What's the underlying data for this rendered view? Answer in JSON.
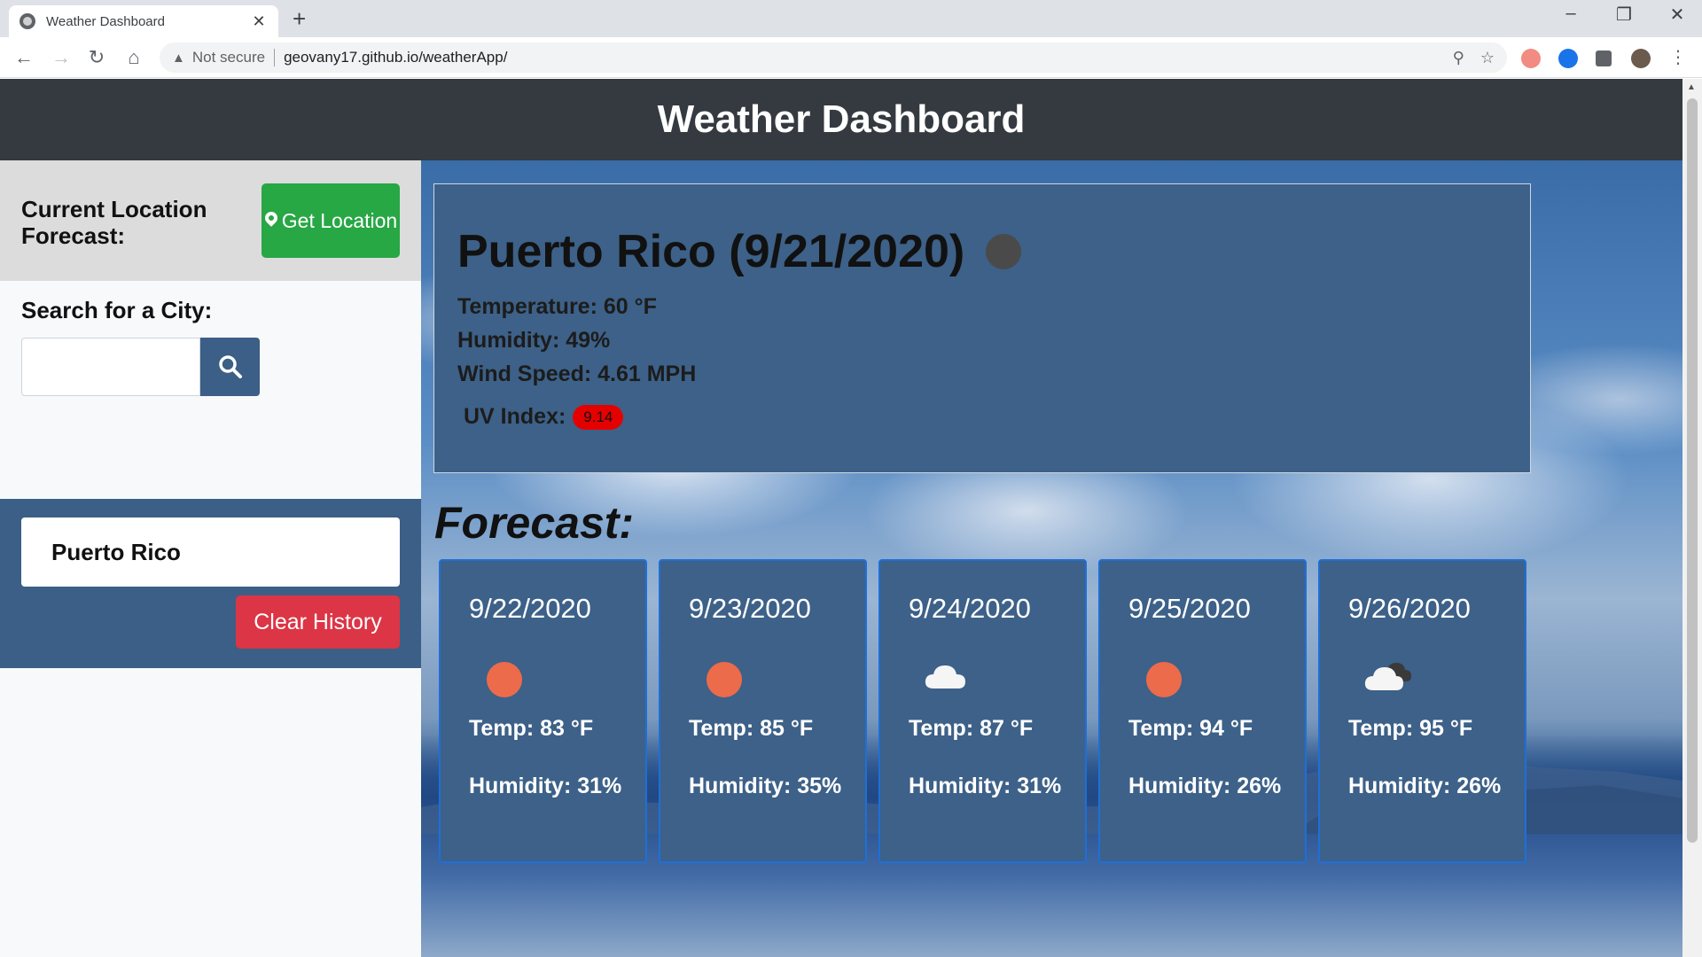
{
  "browser": {
    "tab_title": "Weather Dashboard",
    "tab_close": "✕",
    "new_tab": "+",
    "security_label": "Not secure",
    "url": "geovany17.github.io/weatherApp/"
  },
  "header": {
    "title": "Weather Dashboard"
  },
  "sidebar": {
    "location_label": "Current Location Forecast:",
    "get_location_label": "Get Location",
    "search_label": "Search for a City:",
    "search_value": "",
    "history": [
      "Puerto Rico"
    ],
    "clear_history_label": "Clear History"
  },
  "current": {
    "title": "Puerto Rico (9/21/2020)",
    "icon": "moon-icon",
    "temperature": "Temperature: 60 °F",
    "humidity": "Humidity: 49%",
    "wind": "Wind Speed: 4.61 MPH",
    "uv_label": "UV Index:",
    "uv_value": "9.14",
    "uv_color": "#e50000"
  },
  "forecast": {
    "title": "Forecast:",
    "days": [
      {
        "date": "9/22/2020",
        "icon": "sun-icon",
        "temp": "Temp: 83 °F",
        "humidity": "Humidity: 31%"
      },
      {
        "date": "9/23/2020",
        "icon": "sun-icon",
        "temp": "Temp: 85 °F",
        "humidity": "Humidity: 35%"
      },
      {
        "date": "9/24/2020",
        "icon": "cloud-icon",
        "temp": "Temp: 87 °F",
        "humidity": "Humidity: 31%"
      },
      {
        "date": "9/25/2020",
        "icon": "sun-icon",
        "temp": "Temp: 94 °F",
        "humidity": "Humidity: 26%"
      },
      {
        "date": "9/26/2020",
        "icon": "dark-cloud-icon",
        "temp": "Temp: 95 °F",
        "humidity": "Humidity: 26%"
      }
    ]
  },
  "colors": {
    "header_bg": "#343a40",
    "panel_bg": "#3d6188",
    "history_bg": "#3b5f86",
    "get_location_bg": "#28a745",
    "clear_bg": "#dc3545",
    "sun": "#ec6b4b"
  }
}
